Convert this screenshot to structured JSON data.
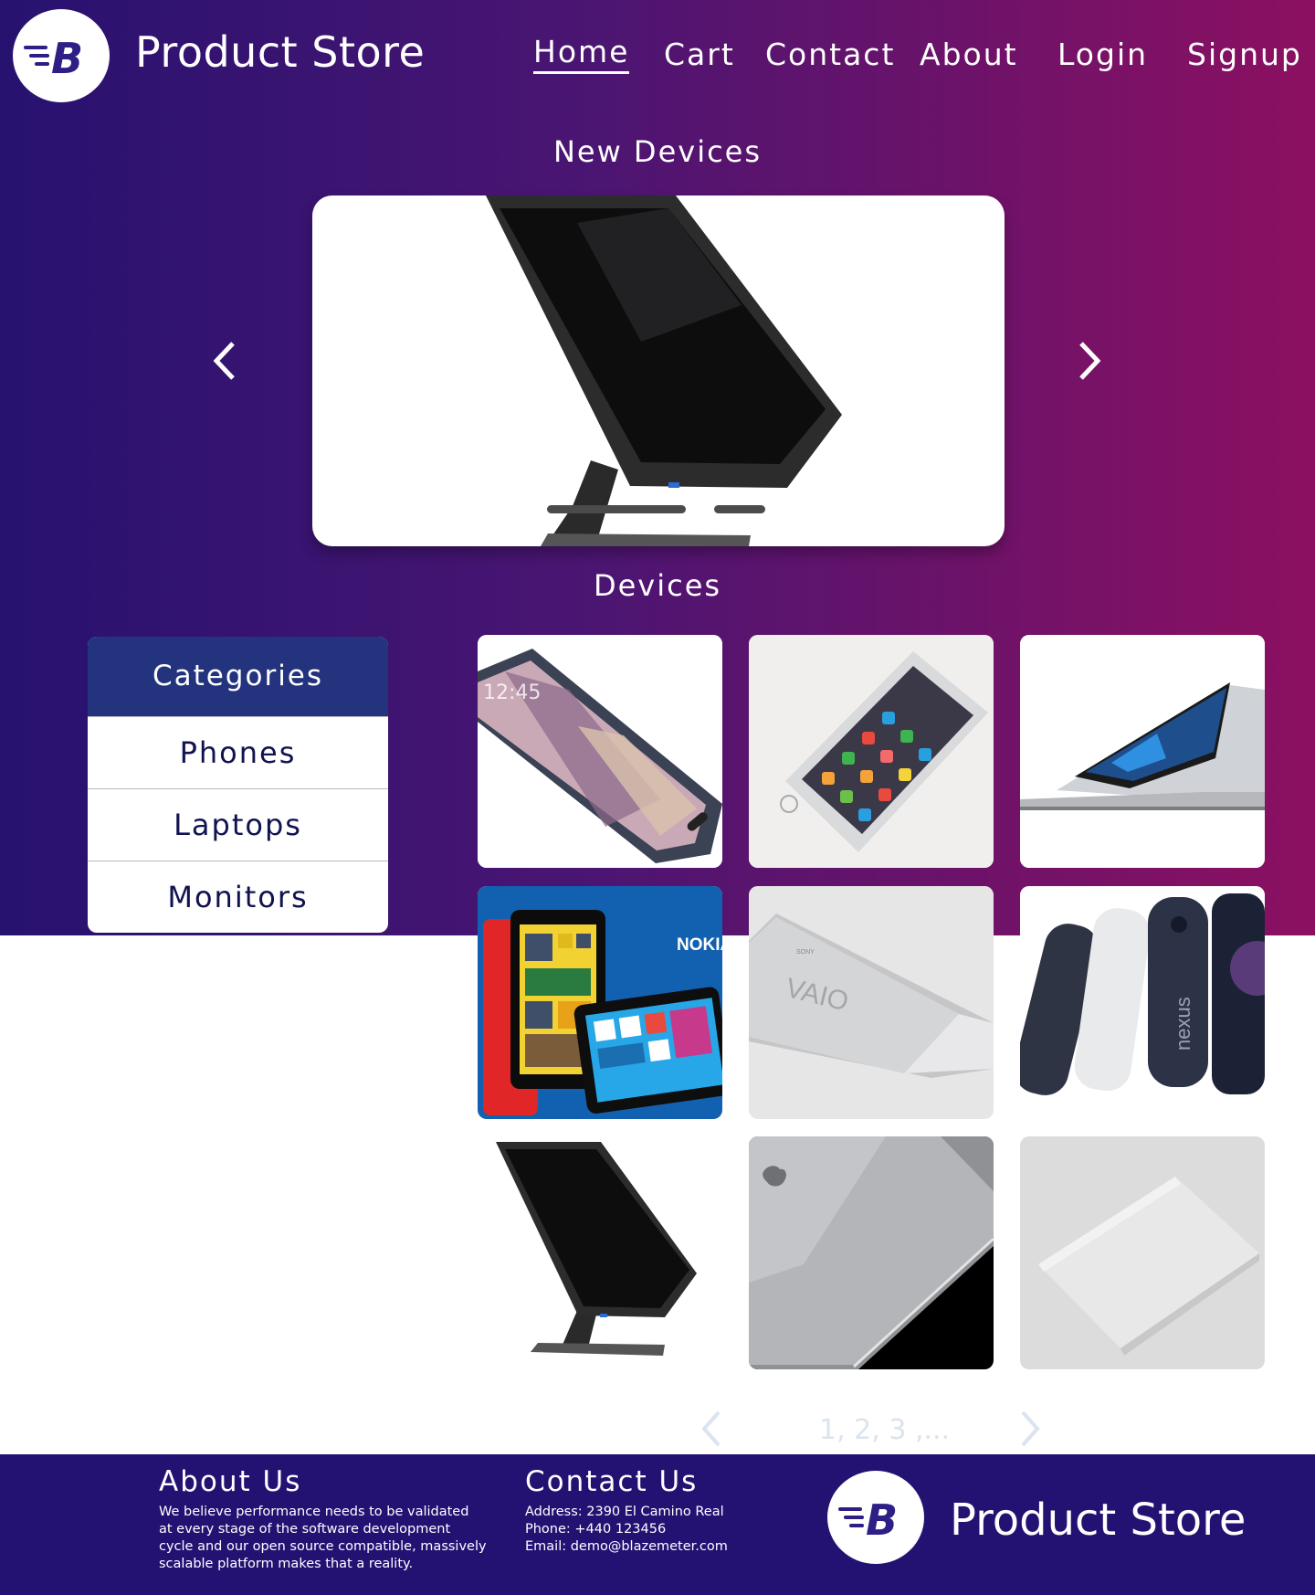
{
  "colors": {
    "gradient_start": "#271270",
    "gradient_end": "#8c1061",
    "category_header": "#24337e",
    "category_text": "#10134f",
    "footer": "#241273",
    "logo_blue": "#2d1f86"
  },
  "header": {
    "logo_icon": "brand-b-icon",
    "brand": "Product Store",
    "nav": {
      "home": "Home",
      "cart": "Cart",
      "contact": "Contact",
      "about": "About",
      "login": "Login",
      "signup": "Signup"
    }
  },
  "carousel": {
    "heading": "New Devices",
    "prev_icon": "chevron-left-icon",
    "next_icon": "chevron-right-icon",
    "slide_image": "monitor"
  },
  "devices": {
    "heading": "Devices"
  },
  "categories": {
    "header": "Categories",
    "items": [
      "Phones",
      "Laptops",
      "Monitors"
    ]
  },
  "products": [
    {
      "image": "samsung-phone"
    },
    {
      "image": "iphone"
    },
    {
      "image": "silver-laptop"
    },
    {
      "image": "nokia-phones",
      "label": "NOKIA"
    },
    {
      "image": "sony-vaio-laptop",
      "label": "VAIO"
    },
    {
      "image": "nexus-phones",
      "label": "nexus"
    },
    {
      "image": "monitor"
    },
    {
      "image": "macbook"
    },
    {
      "image": "xperia-phone"
    }
  ],
  "pagination": {
    "text": "1, 2, 3 ,...",
    "prev_icon": "chevron-left-icon",
    "next_icon": "chevron-right-icon"
  },
  "footer": {
    "about_title": "About Us",
    "about_lines": [
      "We believe performance needs to be validated",
      "at every stage of the software development",
      "cycle and our open source compatible, massively",
      "scalable platform makes that a reality."
    ],
    "contact_title": "Contact Us",
    "address": "Address: 2390 El Camino Real",
    "phone": "Phone: +440 123456",
    "email": "Email: demo@blazemeter.com",
    "brand": "Product Store"
  }
}
